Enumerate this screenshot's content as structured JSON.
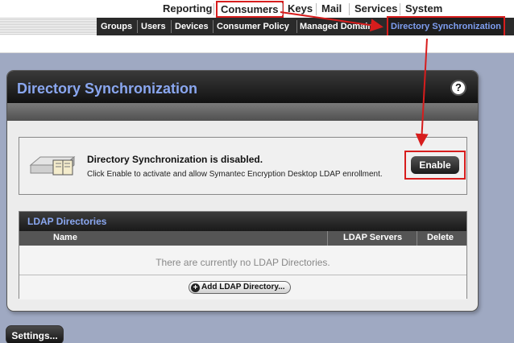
{
  "topnav": {
    "items": [
      "Reporting",
      "Consumers",
      "Keys",
      "Mail",
      "Services",
      "System"
    ],
    "active": "Consumers"
  },
  "subnav": {
    "items": [
      "Groups",
      "Users",
      "Devices",
      "Consumer Policy",
      "Managed Domains",
      "Directory Synchronization"
    ],
    "active": "Directory Synchronization"
  },
  "panel": {
    "title": "Directory Synchronization",
    "help": "?"
  },
  "status": {
    "title": "Directory Synchronization is disabled.",
    "description": "Click Enable to activate and allow Symantec Encryption Desktop LDAP enrollment.",
    "enable_label": "Enable"
  },
  "ldap": {
    "title": "LDAP Directories",
    "columns": [
      "Name",
      "LDAP Servers",
      "Delete"
    ],
    "empty_message": "There are currently no LDAP Directories.",
    "add_label": "Add LDAP Directory..."
  },
  "settings_label": "Settings...",
  "colors": {
    "accent": "#d71d1d",
    "title_blue": "#8aa7f0",
    "background": "#9fa9c2"
  }
}
